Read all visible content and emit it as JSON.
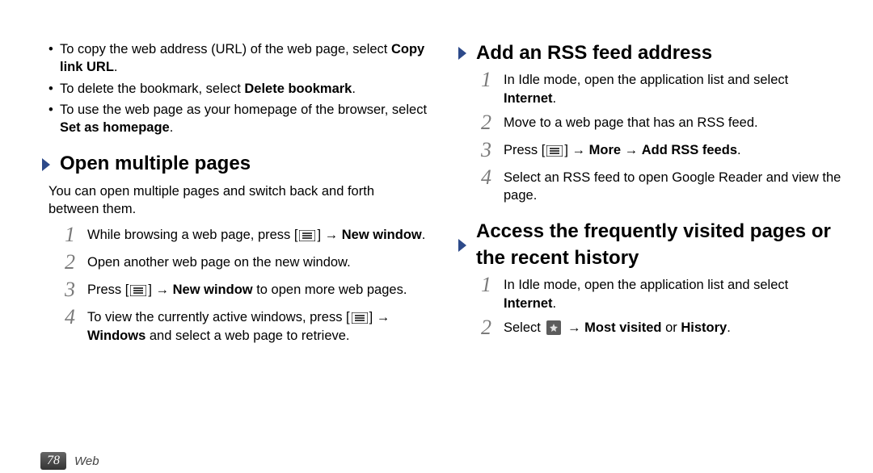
{
  "left": {
    "bullets": [
      {
        "pre": "To copy the web address (URL) of the web page, select ",
        "bold": "Copy link URL",
        "post": "."
      },
      {
        "pre": "To delete the bookmark, select ",
        "bold": "Delete bookmark",
        "post": "."
      },
      {
        "pre": "To use the web page as your homepage of the browser, select ",
        "bold": "Set as homepage",
        "post": "."
      }
    ],
    "h1": "Open multiple pages",
    "desc": "You can open multiple pages and switch back and forth between them.",
    "steps": {
      "s1_pre": "While browsing a web page, press [",
      "s1_mid": "] → ",
      "s1_bold": "New window",
      "s1_post": ".",
      "s2": "Open another web page on the new window.",
      "s3_pre": "Press [",
      "s3_mid": "] → ",
      "s3_bold": "New window",
      "s3_post": " to open more web pages.",
      "s4_pre": "To view the currently active windows, press [",
      "s4_mid": "] → ",
      "s4_bold": "Windows",
      "s4_post": " and select a web page to retrieve."
    }
  },
  "right": {
    "h1": "Add an RSS feed address",
    "r1": {
      "s1_pre": "In Idle mode, open the application list and select ",
      "s1_bold": "Internet",
      "s1_post": ".",
      "s2": "Move to a web page that has an RSS feed.",
      "s3_pre": "Press [",
      "s3_mid": "] → ",
      "s3_b1": "More",
      "s3_arrow": " → ",
      "s3_b2": "Add RSS feeds",
      "s3_post": ".",
      "s4": "Select an RSS feed to open Google Reader and view the page."
    },
    "h2": "Access the frequently visited pages or the recent history",
    "r2": {
      "s1_pre": "In Idle mode, open the application list and select ",
      "s1_bold": "Internet",
      "s1_post": ".",
      "s2_pre": "Select ",
      "s2_arrow": " → ",
      "s2_b1": "Most visited",
      "s2_or": " or ",
      "s2_b2": "History",
      "s2_post": "."
    }
  },
  "footer": {
    "page": "78",
    "section": "Web"
  },
  "nums": {
    "n1": "1",
    "n2": "2",
    "n3": "3",
    "n4": "4"
  },
  "bullet_dot": "•"
}
